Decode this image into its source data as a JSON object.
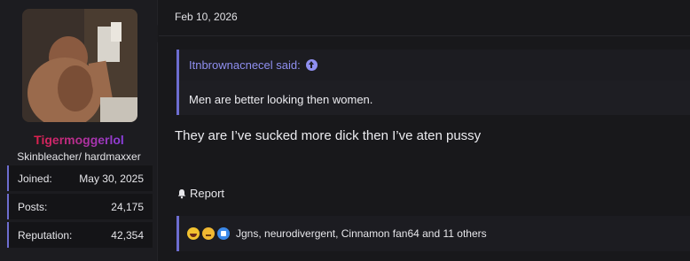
{
  "user": {
    "username": "Tigermoggerlol",
    "username_colors": [
      "#e0204a",
      "#8a3fe0"
    ],
    "user_title": "Skinbleacher/ hardmaxxer",
    "stats": [
      {
        "label": "Joined:",
        "value": "May 30, 2025"
      },
      {
        "label": "Posts:",
        "value": "24,175"
      },
      {
        "label": "Reputation:",
        "value": "42,354"
      }
    ]
  },
  "post": {
    "date": "Feb 10, 2026",
    "quote": {
      "author_line": "Itnbrownacnecel said:",
      "icon": "arrow-up-circle-icon",
      "text": "Men are better looking then women."
    },
    "message": "They are I’ve sucked more dick then I’ve aten pussy",
    "report_label": "Report",
    "report_icon": "bell-icon",
    "reactions": {
      "icons": [
        "laugh-emoji-icon",
        "thinking-emoji-icon",
        "like-thumb-icon"
      ],
      "text": "Jgns, neurodivergent, Cinnamon fan64 and 11 others"
    }
  },
  "colors": {
    "accent": "#6d6dd0",
    "link": "#8f8ff0",
    "background": "#18181b"
  }
}
